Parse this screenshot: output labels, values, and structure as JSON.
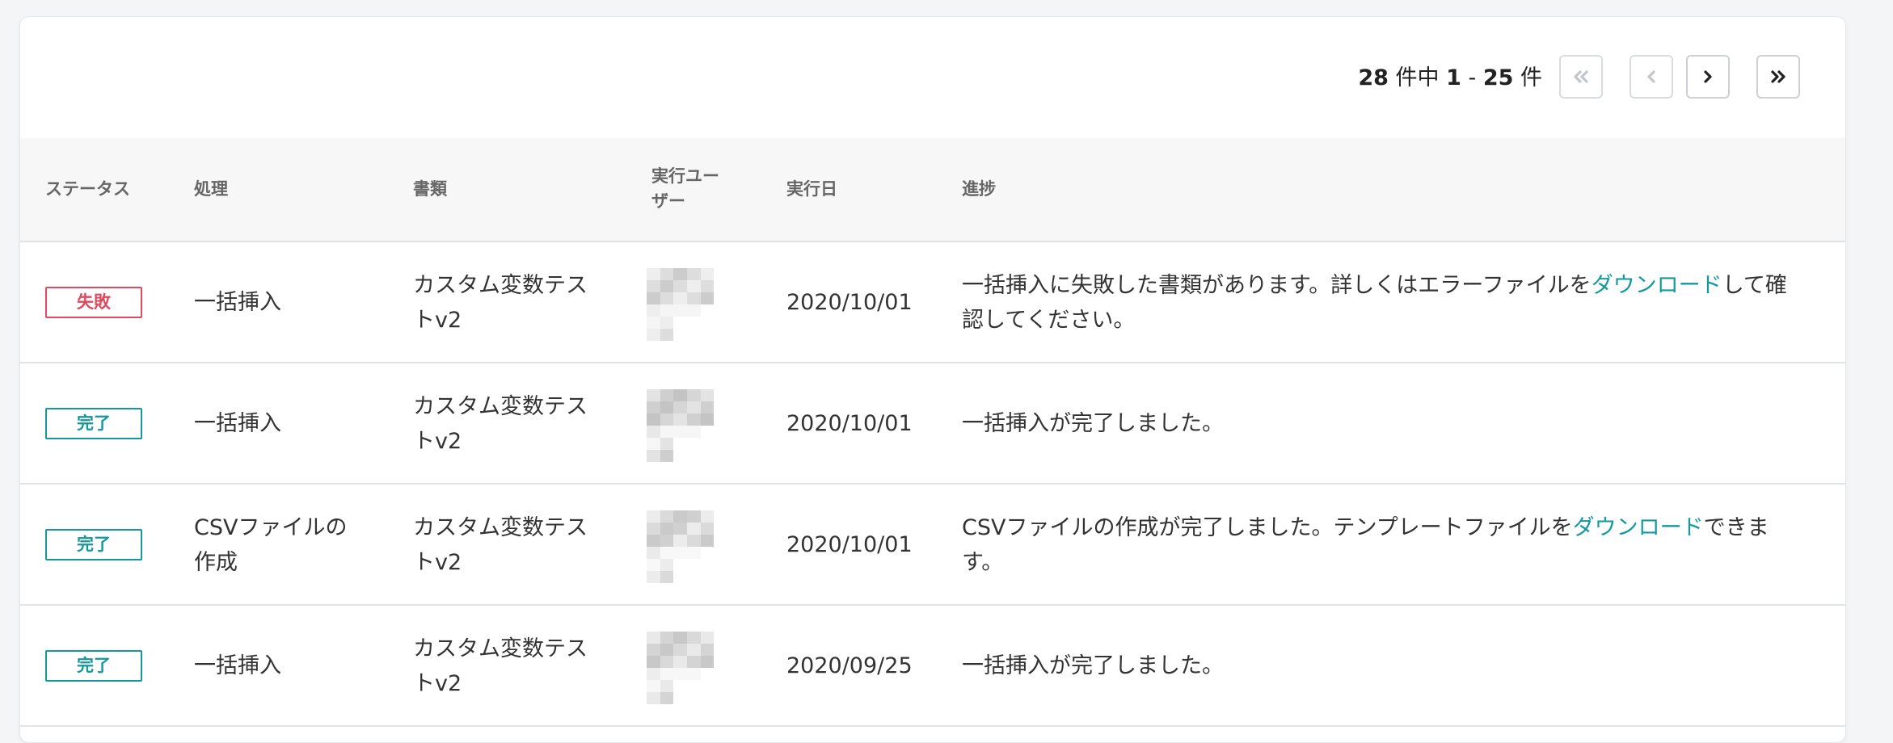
{
  "pagination": {
    "total": "28",
    "of_label": "件中",
    "start": "1",
    "separator": "-",
    "end": "25",
    "unit_label": "件",
    "first_disabled": true,
    "prev_disabled": true
  },
  "table": {
    "headers": {
      "status": "ステータス",
      "process": "処理",
      "document": "書類",
      "user_line1": "実行ユー",
      "user_line2": "ザー",
      "date": "実行日",
      "progress": "進捗"
    },
    "rows": [
      {
        "status": "失敗",
        "status_type": "fail",
        "process_line1": "一括挿入",
        "process_line2": "",
        "document_line1": "カスタム変数テス",
        "document_line2": "トv2",
        "date": "2020/10/01",
        "progress_line1_before": "一括挿入に失敗した書類があります。詳しくはエラーファイルを",
        "progress_link": "ダウンロード",
        "progress_line1_after": "して確",
        "progress_line2": "認してください。"
      },
      {
        "status": "完了",
        "status_type": "done",
        "process_line1": "一括挿入",
        "process_line2": "",
        "document_line1": "カスタム変数テス",
        "document_line2": "トv2",
        "date": "2020/10/01",
        "progress_line1_before": "一括挿入が完了しました。",
        "progress_link": "",
        "progress_line1_after": "",
        "progress_line2": ""
      },
      {
        "status": "完了",
        "status_type": "done",
        "process_line1": "CSVファイルの",
        "process_line2": "作成",
        "document_line1": "カスタム変数テス",
        "document_line2": "トv2",
        "date": "2020/10/01",
        "progress_line1_before": "CSVファイルの作成が完了しました。テンプレートファイルを",
        "progress_link": "ダウンロード",
        "progress_line1_after": "できま",
        "progress_line2": "す。"
      },
      {
        "status": "完了",
        "status_type": "done",
        "process_line1": "一括挿入",
        "process_line2": "",
        "document_line1": "カスタム変数テス",
        "document_line2": "トv2",
        "date": "2020/09/25",
        "progress_line1_before": "一括挿入が完了しました。",
        "progress_link": "",
        "progress_line1_after": "",
        "progress_line2": ""
      }
    ]
  },
  "colors": {
    "fail": "#e04a5f",
    "done": "#13999b",
    "link": "#139aa0",
    "header_bg": "#f7f7f7"
  }
}
